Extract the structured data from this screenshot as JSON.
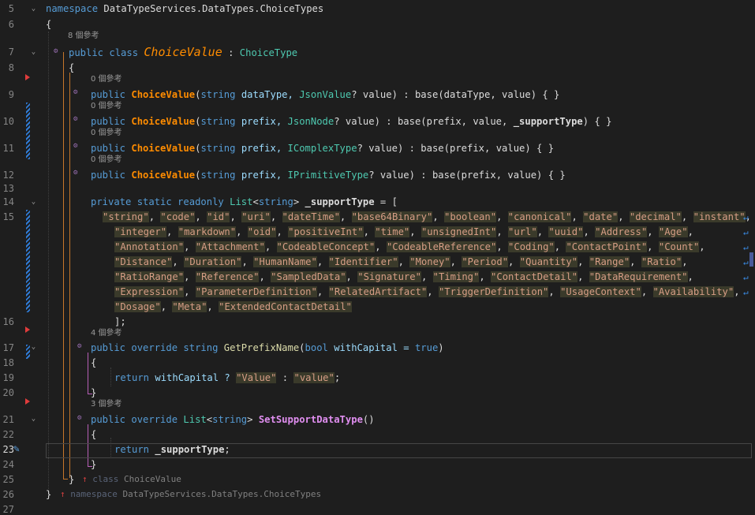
{
  "editor": {
    "line_numbers": [
      "5",
      "6",
      "7",
      "8",
      "9",
      "10",
      "11",
      "12",
      "13",
      "14",
      "15",
      "16",
      "17",
      "18",
      "19",
      "20",
      "21",
      "22",
      "23",
      "24",
      "25",
      "26",
      "27"
    ],
    "code_lens": {
      "class_refs": "8 個參考",
      "ctor1_refs": "0 個參考",
      "ctor2_refs": "0 個參考",
      "ctor3_refs": "0 個參考",
      "ctor4_refs": "0 個參考",
      "getprefix_refs": "4 個參考",
      "setsupport_refs": "3 個參考"
    },
    "code": {
      "ns_kw": "namespace",
      "ns_name": "DataTypeServices.DataTypes.ChoiceTypes",
      "open_brace": "{",
      "close_brace": "}",
      "class_decl_kw": "public class",
      "class_name": "ChoiceValue",
      "colon": " : ",
      "base_type": "ChoiceType",
      "public_kw": "public",
      "ctor_name": "ChoiceValue",
      "string_kw": "string",
      "ctor1_p1": "dataType, ",
      "ctor1_type": "JsonValue",
      "ctor1_rest": "? value) : ",
      "base_kw": "base",
      "ctor1_tail": "(dataType, value) { }",
      "ctor2_p1": "prefix, ",
      "ctor2_type": "JsonNode",
      "ctor2_rest": "? value) : ",
      "ctor2_tail_a": "(prefix, value, ",
      "support_field": "_supportType",
      "ctor2_tail_b": ") { }",
      "ctor3_type": "IComplexType",
      "ctor3_rest": "? value) : ",
      "ctor3_tail": "(prefix, value) { }",
      "ctor4_type": "IPrimitiveType",
      "ctor4_rest": "? value) : ",
      "ctor4_tail": "(prefix, value) { }",
      "field_kw": "private static readonly",
      "list_type": "List",
      "lt": "<",
      "gt": ">",
      "field_assign": " = [",
      "array_close": "];",
      "override_kw": "public override",
      "getprefix_name": "GetPrefixName",
      "getprefix_params_a": "(",
      "bool_kw": "bool",
      "getprefix_param": " withCapital = ",
      "true_kw": "true",
      "paren_close": ")",
      "return_kw": "return",
      "return1_a": " withCapital ? ",
      "return1_s1": "\"Value\"",
      "return1_mid": " : ",
      "return1_s2": "\"value\"",
      "semicolon": ";",
      "setsupport_name": "SetSupportDataType",
      "empty_parens": "()",
      "return2_field": " _supportType",
      "end_class_kw": "class",
      "end_class_name": "ChoiceValue",
      "end_ns_kw": "namespace",
      "end_ns_name": "DataTypeServices.DataTypes.ChoiceTypes",
      "array_rows": [
        [
          "\"string\"",
          "\"code\"",
          "\"id\"",
          "\"uri\"",
          "\"dateTime\"",
          "\"base64Binary\"",
          "\"boolean\"",
          "\"canonical\"",
          "\"date\"",
          "\"decimal\"",
          "\"instant\""
        ],
        [
          "\"integer\"",
          "\"markdown\"",
          "\"oid\"",
          "\"positiveInt\"",
          "\"time\"",
          "\"unsignedInt\"",
          "\"url\"",
          "\"uuid\"",
          "\"Address\"",
          "\"Age\""
        ],
        [
          "\"Annotation\"",
          "\"Attachment\"",
          "\"CodeableConcept\"",
          "\"CodeableReference\"",
          "\"Coding\"",
          "\"ContactPoint\"",
          "\"Count\""
        ],
        [
          "\"Distance\"",
          "\"Duration\"",
          "\"HumanName\"",
          "\"Identifier\"",
          "\"Money\"",
          "\"Period\"",
          "\"Quantity\"",
          "\"Range\"",
          "\"Ratio\""
        ],
        [
          "\"RatioRange\"",
          "\"Reference\"",
          "\"SampledData\"",
          "\"Signature\"",
          "\"Timing\"",
          "\"ContactDetail\"",
          "\"DataRequirement\""
        ],
        [
          "\"Expression\"",
          "\"ParameterDefinition\"",
          "\"RelatedArtifact\"",
          "\"TriggerDefinition\"",
          "\"UsageContext\"",
          "\"Availability\""
        ],
        [
          "\"Dosage\"",
          "\"Meta\"",
          "\"ExtendedContactDetail\""
        ]
      ]
    }
  }
}
